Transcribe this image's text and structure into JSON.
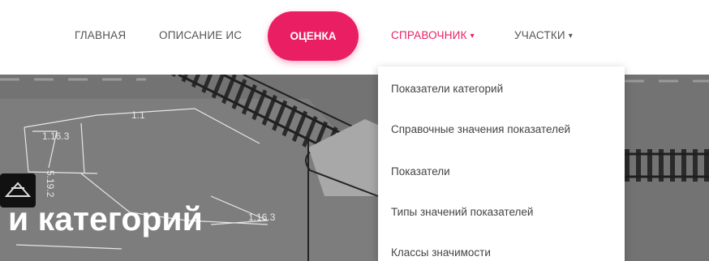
{
  "nav": {
    "home": "ГЛАВНАЯ",
    "description": "ОПИСАНИЕ ИС",
    "assessment": "ОЦЕНКА",
    "reference": "СПРАВОЧНИК",
    "sections": "УЧАСТКИ",
    "caret": "▾"
  },
  "dropdown": {
    "items": [
      "Показатели категорий",
      "Справочные значения показателей",
      "Показатели",
      "Типы значений показателей",
      "Классы значимости"
    ]
  },
  "hero": {
    "title": "и категорий",
    "diagram_labels": [
      "1.1",
      "1.16.3",
      "5.19.2",
      "1.16.3"
    ]
  },
  "colors": {
    "accent": "#e91e63",
    "hero_background": "#737373"
  }
}
